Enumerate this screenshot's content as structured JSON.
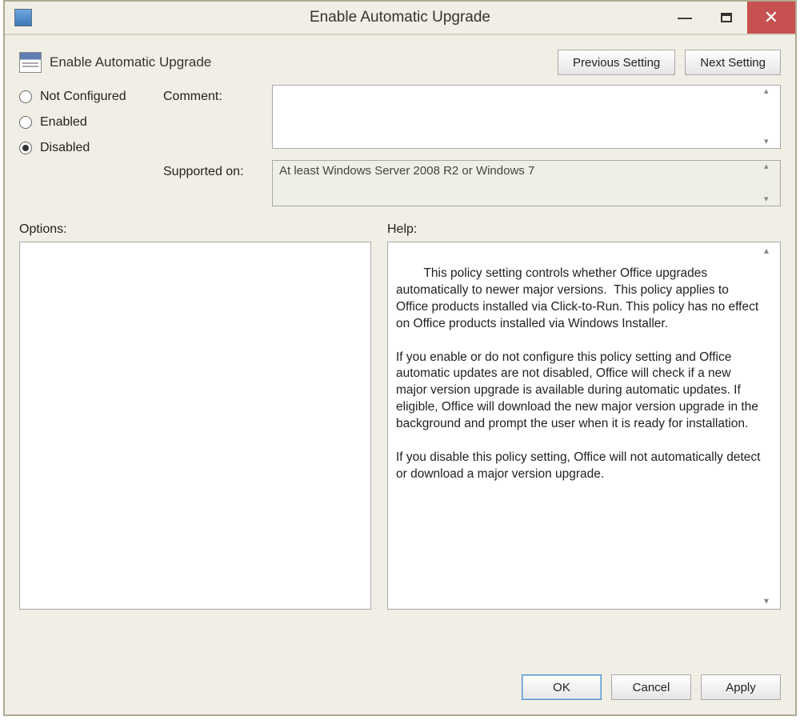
{
  "window": {
    "title": "Enable Automatic Upgrade"
  },
  "policy": {
    "name": "Enable Automatic Upgrade"
  },
  "nav": {
    "prev": "Previous Setting",
    "next": "Next Setting"
  },
  "state": {
    "options": [
      {
        "key": "not_configured",
        "label": "Not Configured",
        "selected": false
      },
      {
        "key": "enabled",
        "label": "Enabled",
        "selected": false
      },
      {
        "key": "disabled",
        "label": "Disabled",
        "selected": true
      }
    ]
  },
  "labels": {
    "comment": "Comment:",
    "supported_on": "Supported on:",
    "options": "Options:",
    "help": "Help:"
  },
  "fields": {
    "comment": "",
    "supported_on": "At least Windows Server 2008 R2 or Windows 7"
  },
  "help_text": "This policy setting controls whether Office upgrades automatically to newer major versions.  This policy applies to Office products installed via Click-to-Run. This policy has no effect on Office products installed via Windows Installer.\n\nIf you enable or do not configure this policy setting and Office automatic updates are not disabled, Office will check if a new major version upgrade is available during automatic updates. If eligible, Office will download the new major version upgrade in the background and prompt the user when it is ready for installation.\n\nIf you disable this policy setting, Office will not automatically detect or download a major version upgrade.",
  "footer": {
    "ok": "OK",
    "cancel": "Cancel",
    "apply": "Apply"
  }
}
